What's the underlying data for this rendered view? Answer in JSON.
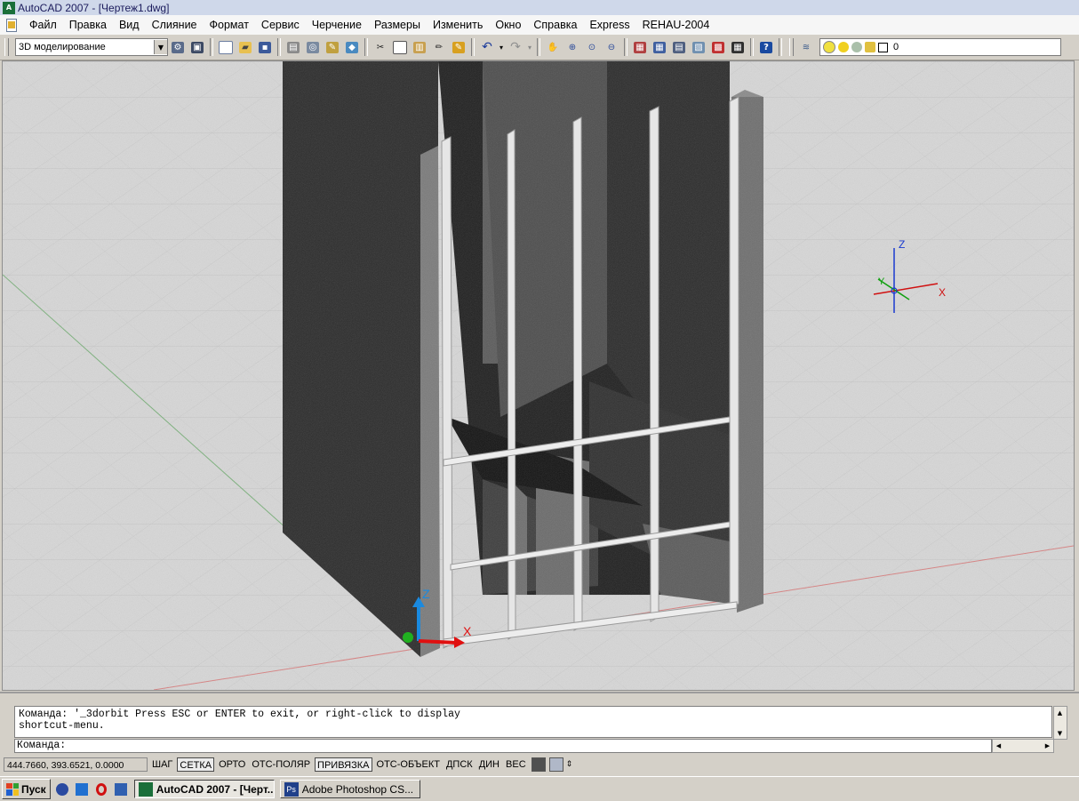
{
  "window": {
    "title": "AutoCAD 2007 - [Чертеж1.dwg]",
    "app_icon_text": "A"
  },
  "menu": {
    "items": [
      "Файл",
      "Правка",
      "Вид",
      "Слияние",
      "Формат",
      "Сервис",
      "Черчение",
      "Размеры",
      "Изменить",
      "Окно",
      "Справка",
      "Express",
      "REHAU-2004"
    ]
  },
  "toolbar": {
    "workspace": "3D моделирование",
    "layer_name": "0",
    "icons": [
      "workspace-settings-icon",
      "workspace-save-icon",
      "new-icon",
      "open-icon",
      "save-icon",
      "print-icon",
      "print-preview-icon",
      "publish-icon",
      "3d-dwf-icon",
      "cut-icon",
      "copy-icon",
      "paste-icon",
      "match-properties-icon",
      "block-editor-icon",
      "undo-icon",
      "redo-icon",
      "pan-icon",
      "zoom-realtime-icon",
      "zoom-window-icon",
      "zoom-previous-icon",
      "properties-icon",
      "design-center-icon",
      "tool-palettes-icon",
      "sheet-set-icon",
      "markup-icon",
      "calculator-icon",
      "help-icon"
    ]
  },
  "viewport": {
    "ucs_x": "X",
    "ucs_y": "Y",
    "ucs_z": "Z",
    "axis_x_color": "#d80000",
    "axis_y_color": "#00a000",
    "axis_z_color": "#0070e0"
  },
  "command": {
    "history": "Команда: '_3dorbit Press ESC or ENTER to exit, or right-click to display\nshortcut-menu.",
    "prompt": "Команда:"
  },
  "status": {
    "coords": "444.7660, 393.6521, 0.0000",
    "toggles": [
      {
        "label": "ШАГ",
        "on": false
      },
      {
        "label": "СЕТКА",
        "on": true
      },
      {
        "label": "ОРТО",
        "on": false
      },
      {
        "label": "ОТС-ПОЛЯР",
        "on": false
      },
      {
        "label": "ПРИВЯЗКА",
        "on": true
      },
      {
        "label": "ОТС-ОБЪЕКТ",
        "on": false
      },
      {
        "label": "ДПСК",
        "on": false
      },
      {
        "label": "ДИН",
        "on": false
      },
      {
        "label": "ВЕС",
        "on": false
      }
    ]
  },
  "taskbar": {
    "start_label": "Пуск",
    "tasks": [
      {
        "label": "AutoCAD 2007 - [Черт...",
        "icon": "autocad-icon",
        "active": true
      },
      {
        "label": "Adobe Photoshop CS...",
        "icon": "photoshop-icon",
        "active": false
      }
    ],
    "photoshop_icon_text": "Ps"
  }
}
